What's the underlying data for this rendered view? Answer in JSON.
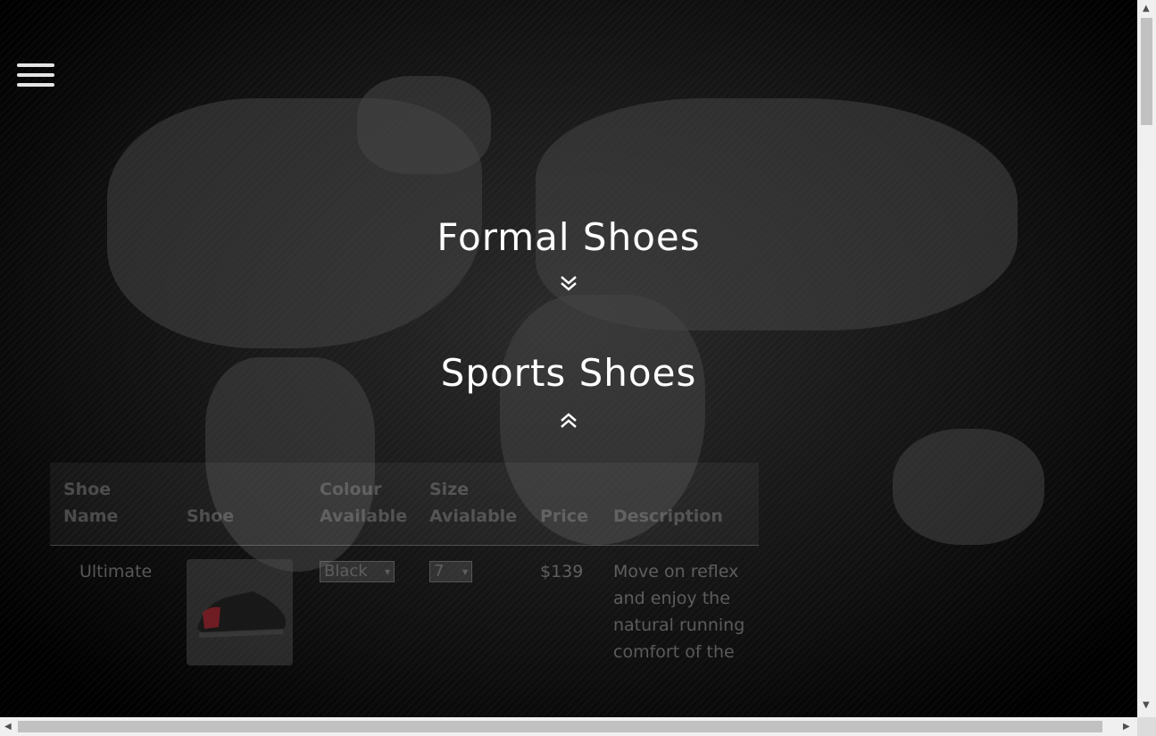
{
  "headings": {
    "formal": "Formal Shoes",
    "sports": "Sports Shoes"
  },
  "icons": {
    "menu": "hamburger-menu-icon",
    "formal_chevron": "chevron-double-down-icon",
    "sports_chevron": "chevron-double-up-icon"
  },
  "table": {
    "headers": {
      "name": "Shoe Name",
      "shoe": "Shoe",
      "colour": "Colour Available",
      "size": "Size Avialable",
      "price": "Price",
      "description": "Description"
    },
    "rows": [
      {
        "name": "Ultimate",
        "colour": "Black",
        "size": "7",
        "price": "$139",
        "description": "Move on reflex and enjoy the natural running comfort of the"
      }
    ]
  },
  "colors": {
    "background": "#000000",
    "text": "#ffffff",
    "scrollbar": "#f0f0f0",
    "scroll_thumb": "#c1c1c1"
  }
}
